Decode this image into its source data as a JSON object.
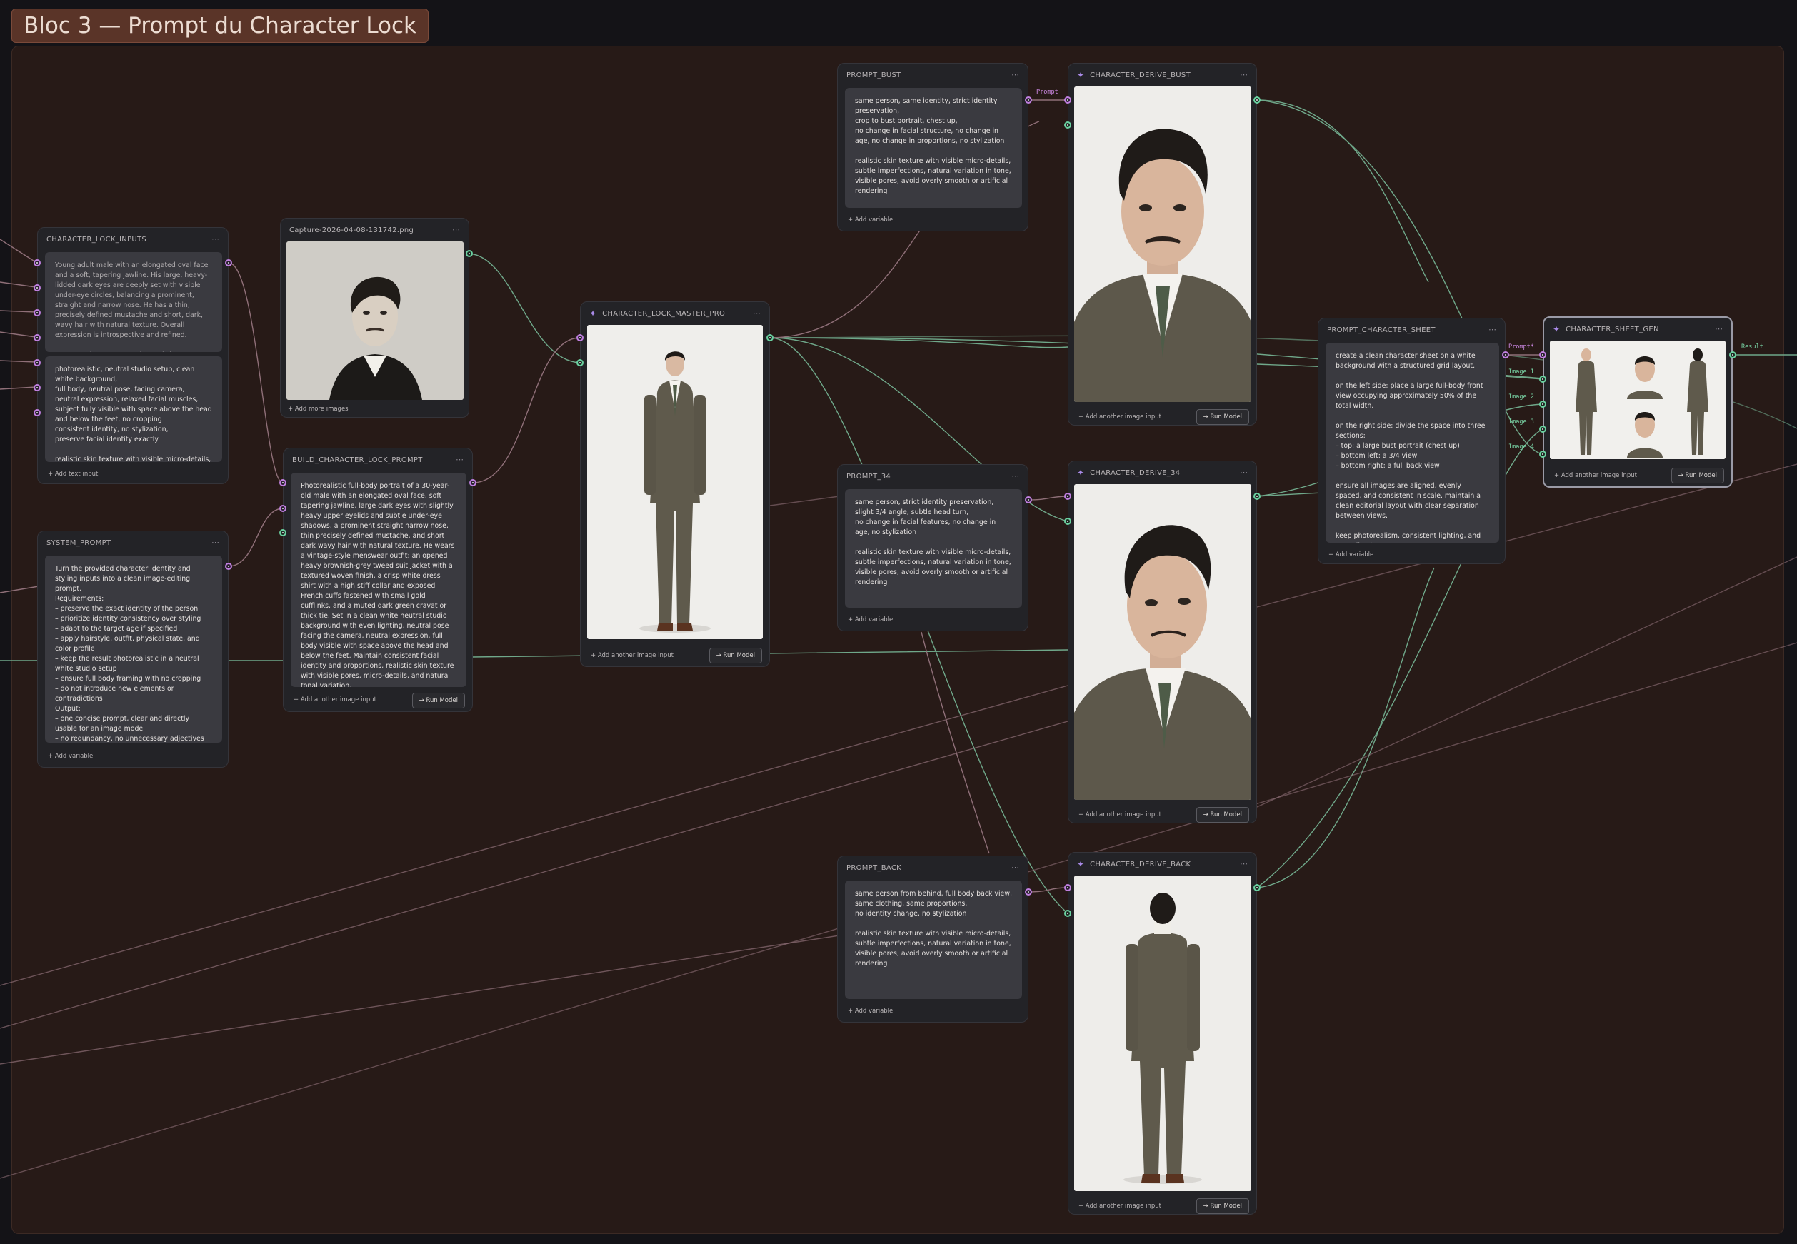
{
  "group": {
    "title": "Bloc 3 — Prompt du Character Lock"
  },
  "nodes": {
    "inputs": {
      "title": "CHARACTER_LOCK_INPUTS",
      "text1": "Young adult male with an elongated oval face and a soft, tapering jawline. His large, heavy-lidded dark eyes are deeply set with visible under-eye circles, balancing a prominent, straight and narrow nose. He has a thin, precisely defined mustache and short, dark, wavy hair with natural texture. Overall expression is introspective and refined.\n\n**Do not change:** eye size and shape, nose prominence and straightness, facial length and",
      "text2": "photorealistic, neutral studio setup, clean white background,\nfull body, neutral pose, facing camera,\nneutral expression, relaxed facial muscles,\nsubject fully visible with space above the head and below the feet, no cropping\nconsistent identity, no stylization,\npreserve facial identity exactly\n\nrealistic skin texture with visible micro-details,",
      "footer": "Add text input"
    },
    "system": {
      "title": "SYSTEM_PROMPT",
      "text": "Turn the provided character identity and styling inputs into a clean image-editing prompt.\nRequirements:\n– preserve the exact identity of the person\n– prioritize identity consistency over styling\n– adapt to the target age if specified\n– apply hairstyle, outfit, physical state, and color profile\n– keep the result photorealistic in a neutral white studio setup\n– ensure full body framing with no cropping\n– do not introduce new elements or contradictions\nOutput:\n– one concise prompt, clear and directly usable for an image model\n– no redundancy, no unnecessary adjectives",
      "footer": "Add variable"
    },
    "capture": {
      "title": "Capture-2026-04-08-131742.png",
      "footer": "Add more images"
    },
    "build": {
      "title": "BUILD_CHARACTER_LOCK_PROMPT",
      "text": "Photorealistic full-body portrait of a 30-year-old male with an elongated oval face, soft tapering jawline, large dark eyes with slightly heavy upper eyelids and subtle under-eye shadows, a prominent straight narrow nose, thin precisely defined mustache, and short dark wavy hair with natural texture. He wears a vintage-style menswear outfit: an opened heavy brownish-grey tweed suit jacket with a textured woven finish, a crisp white dress shirt with a high stiff collar and exposed French cuffs fastened with small gold cufflinks, and a muted dark green cravat or thick tie. Set in a clean white neutral studio background with even lighting, neutral pose facing the camera, neutral expression, full body visible with space above the head and below the feet. Maintain consistent facial identity and proportions, realistic skin texture with visible pores, micro-details, and natural tonal variation.",
      "footer": "Add another image input",
      "run": "Run Model"
    },
    "master": {
      "title": "CHARACTER_LOCK_MASTER_PRO",
      "footer": "Add another image input",
      "run": "Run Model"
    },
    "prompt_bust": {
      "title": "PROMPT_BUST",
      "text": "same person, same identity, strict identity preservation,\ncrop to bust portrait, chest up,\nno change in facial structure, no change in age, no change in proportions, no stylization\n\nrealistic skin texture with visible micro-details, subtle imperfections, natural variation in tone, visible pores, avoid overly smooth or artificial rendering",
      "footer": "Add variable"
    },
    "prompt_34": {
      "title": "PROMPT_34",
      "text": "same person, strict identity preservation,\nslight 3/4 angle, subtle head turn,\nno change in facial features, no change in age, no stylization\n\nrealistic skin texture with visible micro-details, subtle imperfections, natural variation in tone, visible pores, avoid overly smooth or artificial rendering",
      "footer": "Add variable"
    },
    "prompt_back": {
      "title": "PROMPT_BACK",
      "text": "same person from behind, full body back view,\nsame clothing, same proportions,\nno identity change, no stylization\n\nrealistic skin texture with visible micro-details, subtle imperfections, natural variation in tone, visible pores, avoid overly smooth or artificial rendering",
      "footer": "Add variable"
    },
    "derive_bust": {
      "title": "CHARACTER_DERIVE_BUST",
      "footer": "Add another image input",
      "run": "Run Model"
    },
    "derive_34": {
      "title": "CHARACTER_DERIVE_34",
      "footer": "Add another image input",
      "run": "Run Model"
    },
    "derive_back": {
      "title": "CHARACTER_DERIVE_BACK",
      "footer": "Add another image input",
      "run": "Run Model"
    },
    "prompt_sheet": {
      "title": "PROMPT_CHARACTER_SHEET",
      "text": "create a clean character sheet on a white background with a structured grid layout.\n\non the left side: place a large full-body front view occupying approximately 50% of the total width.\n\non the right side: divide the space into three sections:\n– top: a large bust portrait (chest up)\n– bottom left: a 3/4 view\n– bottom right: a full back view\n\nensure all images are aligned, evenly spaced, and consistent in scale. maintain a clean editorial layout with clear separation between views.\n\nkeep photorealism, consistent lighting, and no stylization.",
      "footer": "Add variable"
    },
    "sheet_gen": {
      "title": "CHARACTER_SHEET_GEN",
      "footer": "Add another image input",
      "run": "Run Model"
    }
  },
  "port_labels": {
    "prompt": "Prompt",
    "prompt_req": "Prompt*",
    "image1": "Image 1",
    "image2": "Image 2",
    "image3": "Image 3",
    "image4": "Image 4",
    "result": "Result"
  },
  "icons": {
    "menu": "ellipsis-icon",
    "spark": "sparkle-icon",
    "plus": "plus-icon",
    "arrow": "arrow-right-icon"
  },
  "colors": {
    "background": "#141317",
    "group_frame": "#271a17",
    "group_title": "#5a3428",
    "node": "#232327",
    "text_box": "#3a3a40",
    "port_text": "#c07fe0",
    "port_image": "#6ad0a0",
    "wire_text": "#8f6f78",
    "wire_image": "#6fa88a"
  }
}
